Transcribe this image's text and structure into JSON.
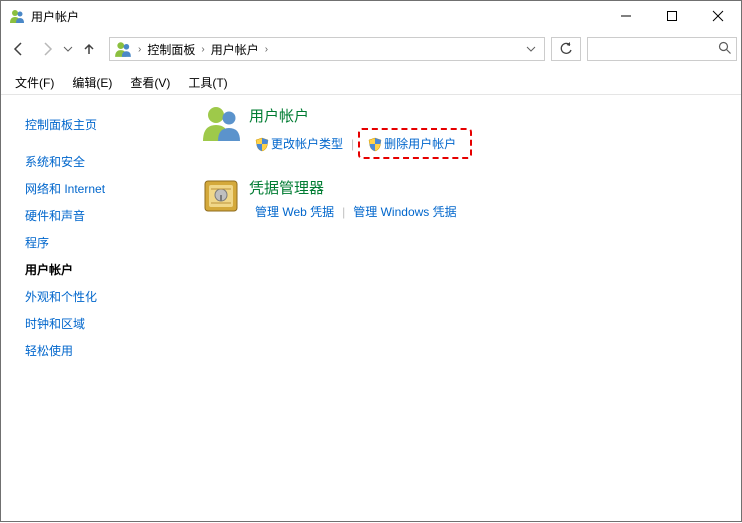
{
  "window": {
    "title": "用户帐户"
  },
  "breadcrumb": {
    "items": [
      "控制面板",
      "用户帐户"
    ]
  },
  "menubar": {
    "items": [
      "文件(F)",
      "编辑(E)",
      "查看(V)",
      "工具(T)"
    ]
  },
  "sidebar": {
    "items": [
      {
        "label": "控制面板主页",
        "current": false
      },
      {
        "label": "系统和安全",
        "current": false
      },
      {
        "label": "网络和 Internet",
        "current": false
      },
      {
        "label": "硬件和声音",
        "current": false
      },
      {
        "label": "程序",
        "current": false
      },
      {
        "label": "用户帐户",
        "current": true
      },
      {
        "label": "外观和个性化",
        "current": false
      },
      {
        "label": "时钟和区域",
        "current": false
      },
      {
        "label": "轻松使用",
        "current": false
      }
    ]
  },
  "main": {
    "user_accounts": {
      "title": "用户帐户",
      "change_type": "更改帐户类型",
      "delete_user": "删除用户帐户"
    },
    "credential_manager": {
      "title": "凭据管理器",
      "manage_web": "管理 Web 凭据",
      "manage_windows": "管理 Windows 凭据"
    }
  },
  "search": {
    "placeholder": ""
  }
}
